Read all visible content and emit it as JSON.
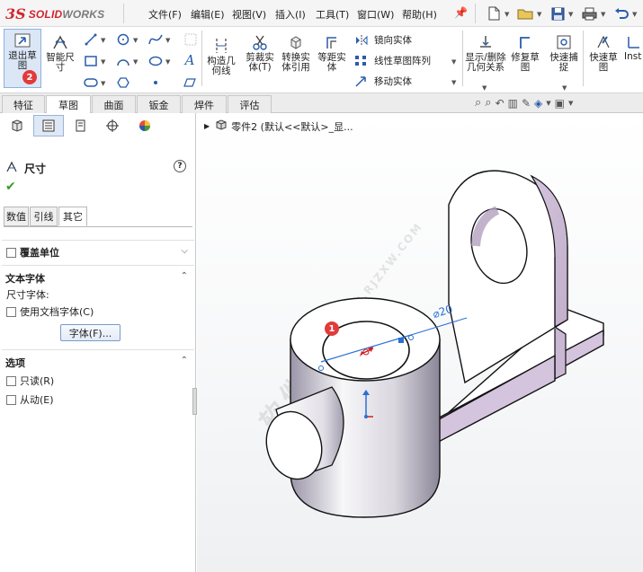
{
  "app": {
    "logo_ds": "3S",
    "logo_solid": "SOLID",
    "logo_works": "WORKS"
  },
  "menu": {
    "file": "文件(F)",
    "edit": "编辑(E)",
    "view": "视图(V)",
    "insert": "插入(I)",
    "tools": "工具(T)",
    "window": "窗口(W)",
    "help": "帮助(H)"
  },
  "ribbon": {
    "exit_sketch": "退出草图",
    "smart_dim": "智能尺寸",
    "construct_geom": "构造几何线",
    "trim": "剪裁实体(T)",
    "convert": "转换实体引用",
    "offset": "等距实体",
    "mirror": "镜向实体",
    "linear_pattern": "线性草图阵列",
    "move": "移动实体",
    "display_relations": "显示/删除几何关系",
    "repair": "修复草图",
    "quick_snap": "快速捕捉",
    "rapid_sketch": "快速草图",
    "instant2d": "Inst"
  },
  "tabs": [
    "特征",
    "草图",
    "曲面",
    "钣金",
    "焊件",
    "评估"
  ],
  "panel": {
    "title": "尺寸",
    "sub_tabs": [
      "数值",
      "引线",
      "其它"
    ],
    "override_units": "覆盖单位",
    "text_font": "文本字体",
    "dim_font_label": "尺寸字体:",
    "use_doc_font": "使用文档字体(C)",
    "font_button": "字体(F)...",
    "options": "选项",
    "readonly": "只读(R)",
    "driven": "从动(E)"
  },
  "tree": {
    "label": "零件2 (默认<<默认>_显..."
  },
  "dimension": {
    "text": "⌀20"
  },
  "badges": {
    "one": "1",
    "two": "2"
  },
  "watermark": {
    "line1": "软件自学网",
    "line2": "WWW.RJZXW.COM"
  }
}
